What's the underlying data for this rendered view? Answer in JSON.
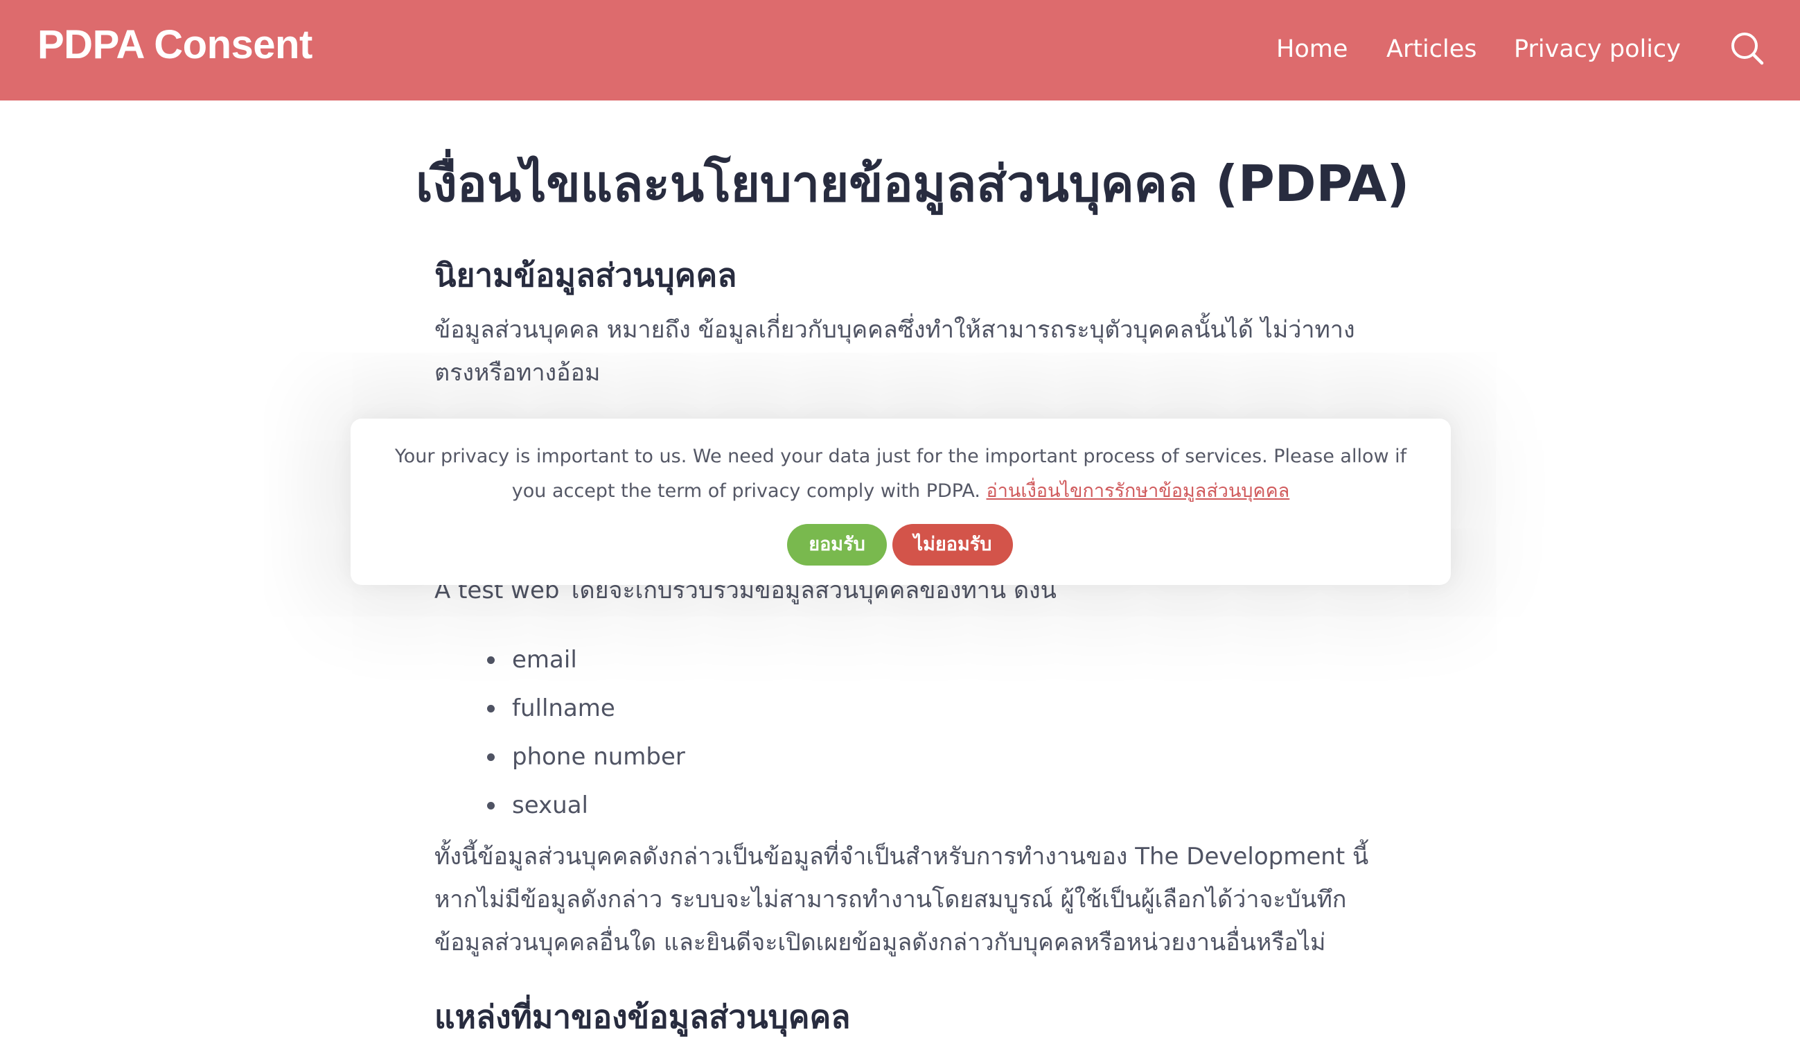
{
  "header": {
    "brand": "PDPA Consent",
    "nav": [
      {
        "label": "Home"
      },
      {
        "label": "Articles"
      },
      {
        "label": "Privacy policy"
      }
    ],
    "search_icon": "search-icon"
  },
  "main": {
    "title": "เงื่อนไขและนโยบายข้อมูลส่วนบุคคล (PDPA)",
    "definition_heading": "นิยามข้อมูลส่วนบุคคล",
    "definition_text": "ข้อมูลส่วนบุคคล หมายถึง ข้อมูลเกี่ยวกับบุคคลซึ่งทำให้สามารถระบุตัวบุคคลนั้นได้ ไม่ว่าทางตรงหรือทางอ้อม",
    "collection_text": "A test web โดยจะเก็บรวบรวมข้อมูลส่วนบุคคลของท่าน ดังนี",
    "collected_items": [
      "email",
      "fullname",
      "phone number",
      "sexual"
    ],
    "note_text": "ทั้งนี้ข้อมูลส่วนบุคคลดังกล่าวเป็นข้อมูลที่จำเป็นสำหรับการทำงานของ The Development นี้ หากไม่มีข้อมูลดังกล่าว ระบบจะไม่สามารถทำงานโดยสมบูรณ์ ผู้ใช้เป็นผู้เลือกได้ว่าจะบันทึกข้อมูลส่วนบุคคลอื่นใด และยินดีจะเปิดเผยข้อมูลดังกล่าวกับบุคคลหรือหน่วยงานอื่นหรือไม่",
    "sources_heading": "แหล่งที่มาของข้อมูลส่วนบุคคล"
  },
  "consent": {
    "message": "Your privacy is important to us. We need your data just for the important process of services. Please allow if you accept the term of privacy comply with PDPA.",
    "link_text": "อ่านเงื่อนไขการรักษาข้อมูลส่วนบุคคล",
    "accept_label": "ยอมรับ",
    "decline_label": "ไม่ยอมรับ"
  },
  "colors": {
    "header_bg": "#dd6b6d",
    "accept": "#79b94e",
    "decline": "#d3544a",
    "link": "#d05a5c",
    "heading": "#282c3f"
  }
}
